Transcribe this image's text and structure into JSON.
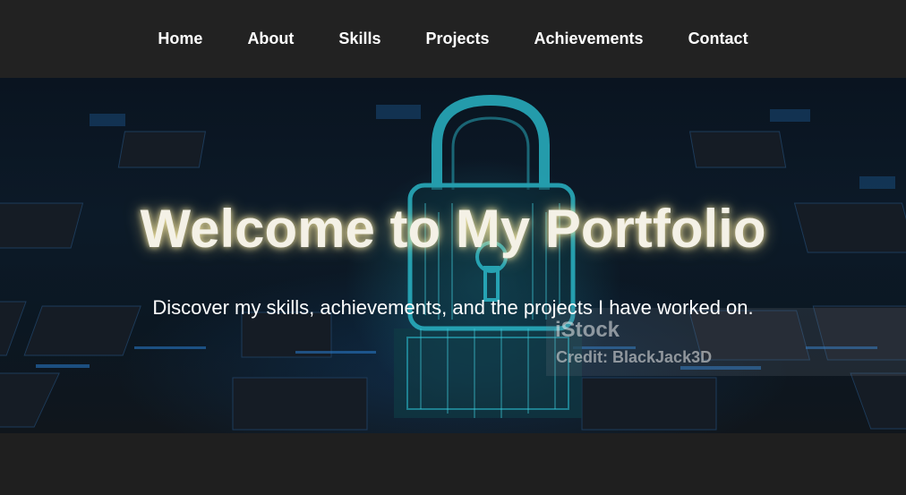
{
  "nav": {
    "items": [
      {
        "label": "Home"
      },
      {
        "label": "About"
      },
      {
        "label": "Skills"
      },
      {
        "label": "Projects"
      },
      {
        "label": "Achievements"
      },
      {
        "label": "Contact"
      }
    ]
  },
  "hero": {
    "title": "Welcome to My Portfolio",
    "subtitle": "Discover my skills, achievements, and the projects I have worked on.",
    "watermark_logo": "iStock",
    "watermark_credit": "Credit: BlackJack3D"
  },
  "colors": {
    "nav_background": "#222222",
    "page_background": "#1e1e1e",
    "title_glow": "#ffe88c",
    "lock_accent": "#2ab3c4"
  },
  "icons": {
    "hero_image": "padlock-circuit-image"
  }
}
